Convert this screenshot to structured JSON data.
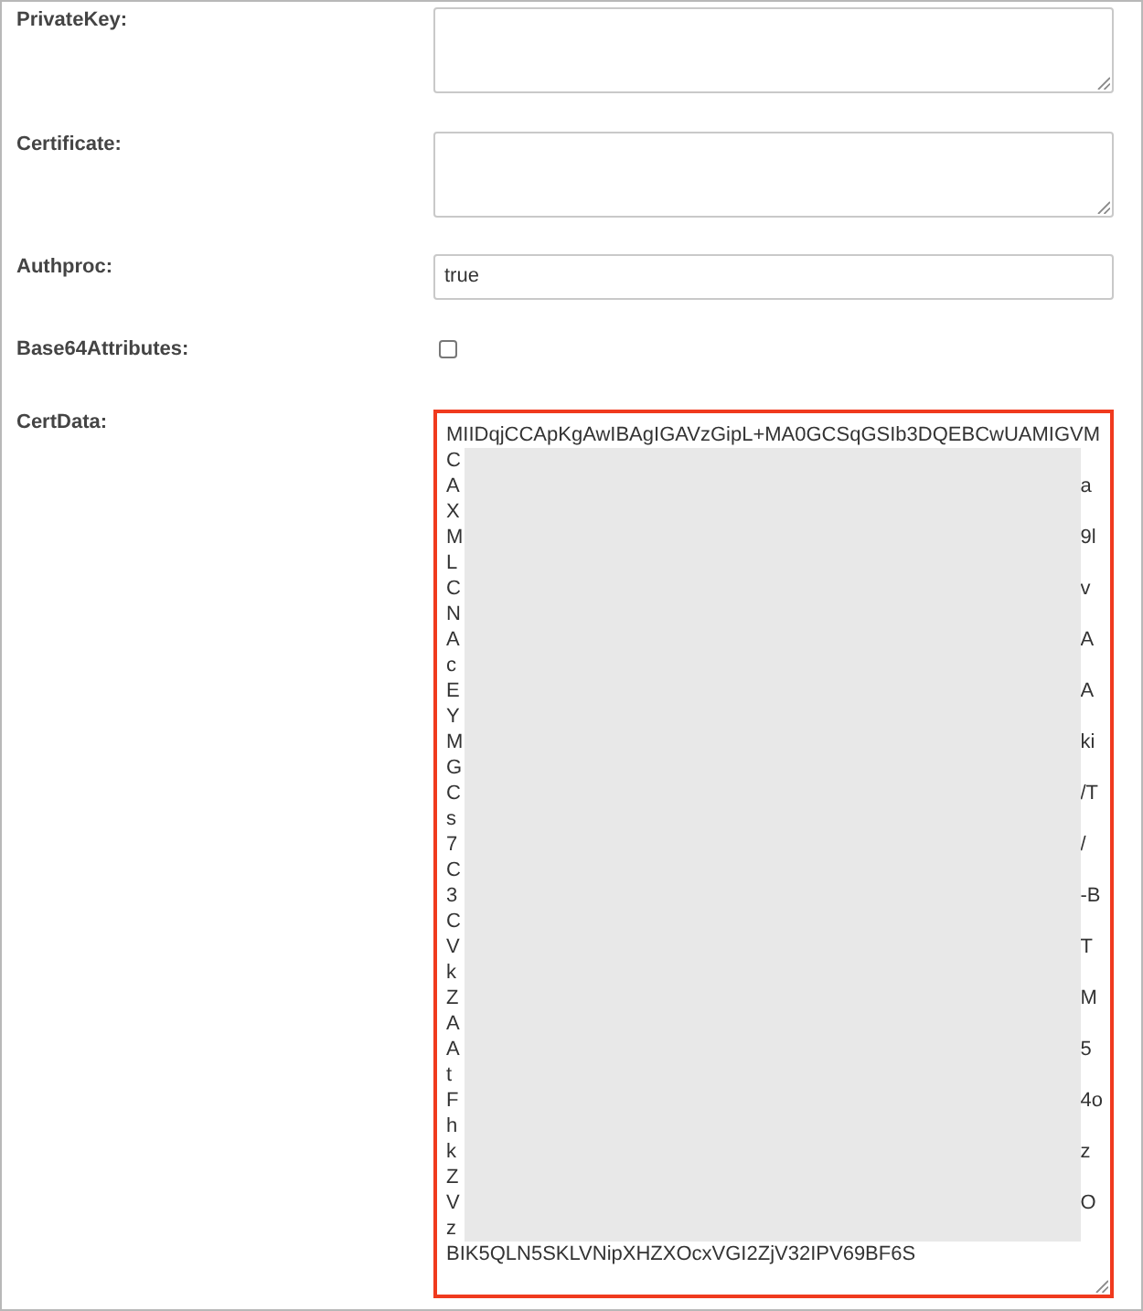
{
  "fields": [
    {
      "kind": "textarea",
      "label": "PrivateKey:"
    },
    {
      "kind": "textarea",
      "label": "Certificate:"
    },
    {
      "kind": "input",
      "label": "Authproc:",
      "value": "true"
    },
    {
      "kind": "checkbox",
      "label": "Base64Attributes:",
      "checked": false
    },
    {
      "kind": "textarea",
      "label": "CertData:",
      "highlighted": true,
      "redacted": true,
      "lines": [
        {
          "text": "MIIDqjCCApKgAwIBAgIGAVzGipL+MA0GCSqGSIb3DQEBCwUAMIGVM"
        },
        {
          "start": "C"
        },
        {
          "start": "A",
          "end": "a"
        },
        {
          "start": "X"
        },
        {
          "start": "M",
          "end": "9l"
        },
        {
          "start": "L"
        },
        {
          "start": "C",
          "end": "v"
        },
        {
          "start": "N"
        },
        {
          "start": "A",
          "end": "A"
        },
        {
          "start": "c"
        },
        {
          "start": "E",
          "end": "A"
        },
        {
          "start": "Y"
        },
        {
          "start": "M",
          "end": "ki"
        },
        {
          "start": "G"
        },
        {
          "start": "C",
          "end": "/T"
        },
        {
          "start": "s"
        },
        {
          "start": "7",
          "end": "/"
        },
        {
          "start": "C"
        },
        {
          "start": "3",
          "end": "-B"
        },
        {
          "start": "C"
        },
        {
          "start": "V",
          "end": "T"
        },
        {
          "start": "k"
        },
        {
          "start": "Z",
          "end": "M"
        },
        {
          "start": "A"
        },
        {
          "start": "A",
          "end": "5"
        },
        {
          "start": "t"
        },
        {
          "start": "F",
          "end": "4o"
        },
        {
          "start": "h"
        },
        {
          "start": "k",
          "end": "z"
        },
        {
          "start": "Z"
        },
        {
          "start": "V",
          "end": "O"
        },
        {
          "start": "z"
        },
        {
          "text": "BIK5QLN5SKLVNipXHZXOcxVGI2ZjV32IPV69BF6S"
        }
      ]
    }
  ]
}
